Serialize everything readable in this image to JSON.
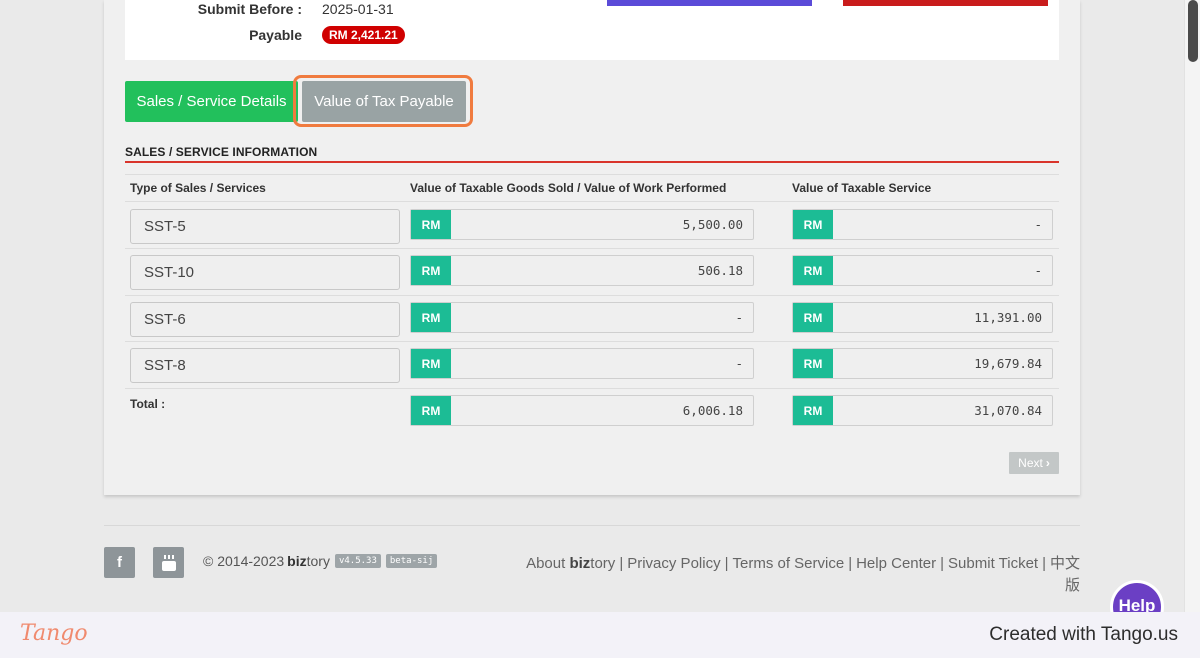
{
  "header": {
    "submit_before_label": "Submit Before :",
    "submit_before_value": "2025-01-31",
    "payable_label": "Payable",
    "payable_value": "RM 2,421.21"
  },
  "tabs": [
    {
      "label": "Sales / Service Details"
    },
    {
      "label": "Value of Tax Payable"
    }
  ],
  "section": {
    "title": "SALES / SERVICE INFORMATION"
  },
  "table": {
    "columns": [
      "Type of Sales / Services",
      "Value of Taxable Goods Sold / Value of Work Performed",
      "Value of Taxable Service"
    ],
    "currency": "RM",
    "rows": [
      {
        "type": "SST-5",
        "goods": "5,500.00",
        "service": "-"
      },
      {
        "type": "SST-10",
        "goods": "506.18",
        "service": "-"
      },
      {
        "type": "SST-6",
        "goods": "-",
        "service": "11,391.00"
      },
      {
        "type": "SST-8",
        "goods": "-",
        "service": "19,679.84"
      }
    ],
    "total_label": "Total :",
    "total_goods": "6,006.18",
    "total_service": "31,070.84"
  },
  "next_label": "Next",
  "footer": {
    "copyright_prefix": "© 2014-2023",
    "brand_bold": "biz",
    "brand_rest": "tory",
    "version": "v4.5.33",
    "tag": "beta-sij",
    "links": {
      "about_prefix": "About",
      "about_bold": "biz",
      "about_rest": "tory",
      "privacy": "Privacy Policy",
      "terms": "Terms of Service",
      "help_center": "Help Center",
      "submit_ticket": "Submit Ticket",
      "chinese": "中文版"
    }
  },
  "help_bubble": "Help",
  "tango": {
    "logo": "Tango",
    "credit": "Created with Tango.us"
  }
}
